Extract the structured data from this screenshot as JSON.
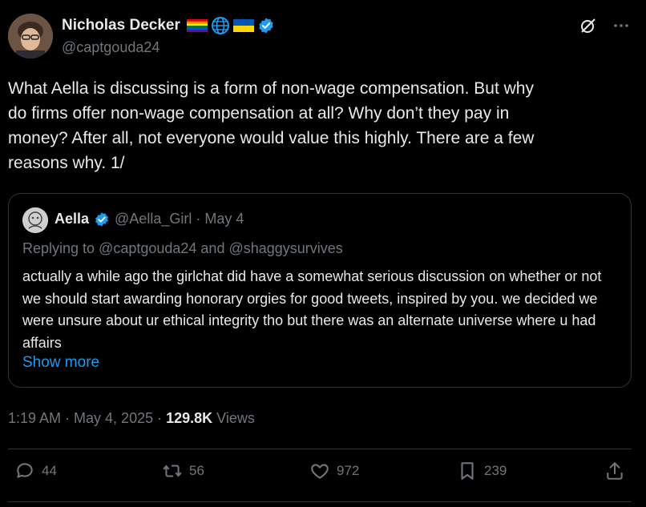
{
  "author": {
    "name": "Nicholas Decker",
    "handle": "@captgouda24"
  },
  "tweet": {
    "text": "What Aella is discussing is a form of non-wage compensation. But why\ndo firms offer non-wage compensation at all? Why don’t they pay in\nmoney? After all, not everyone would value this highly. There are a few\nreasons why. 1/"
  },
  "quote": {
    "name": "Aella",
    "handle_date": "@Aella_Girl · May 4",
    "replying": "Replying to @captgouda24 and @shaggysurvives",
    "text": "actually a while ago the girlchat did have a somewhat serious discussion on whether or not we should start awarding honorary orgies for good tweets, inspired by you. we decided we were unsure about ur ethical integrity tho but there was an alternate universe where u had affairs",
    "show_more": "Show more"
  },
  "meta": {
    "timestamp": "1:19 AM · May 4, 2025 · ",
    "views": "129.8K",
    "views_label": " Views"
  },
  "actions": {
    "replies": "44",
    "reposts": "56",
    "likes": "972",
    "bookmarks": "239"
  },
  "icons": [
    "grok-icon",
    "more-icon",
    "verified-icon",
    "reply-icon",
    "repost-icon",
    "like-icon",
    "bookmark-icon",
    "share-icon"
  ],
  "colors": {
    "background": "#000000",
    "text": "#e7e9ea",
    "muted": "#71767b",
    "accent": "#1d9bf0",
    "border": "#2f3336"
  }
}
